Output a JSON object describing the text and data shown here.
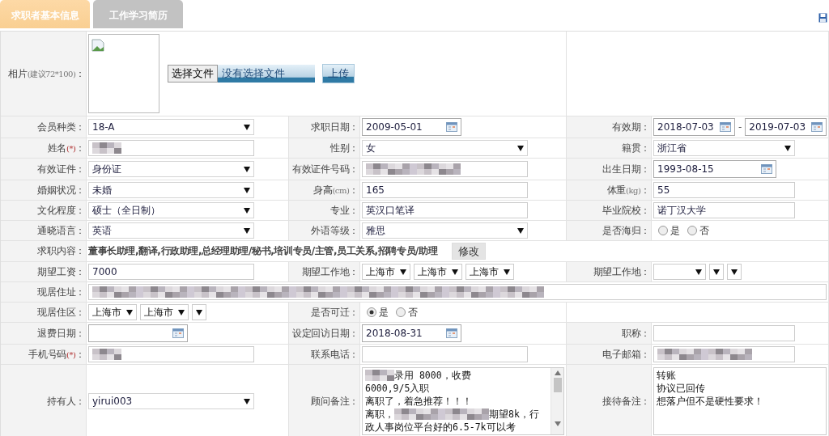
{
  "tabs": [
    {
      "label": "求职者基本信息",
      "selected": true
    },
    {
      "label": "工作学习简历",
      "selected": false
    }
  ],
  "rows": [
    {
      "fields": [
        {
          "label": [
            {
              "text": "相片"
            },
            {
              "text": "(建议72*100)",
              "kind": "note"
            },
            {
              "text": "："
            }
          ],
          "control": {
            "kind": "upload",
            "choose": "选择文件",
            "status": "没有选择文件",
            "upload": "上传"
          }
        }
      ]
    },
    {
      "fields": [
        {
          "label": "会员种类：",
          "control": {
            "kind": "select",
            "value": "18-A"
          }
        },
        {
          "label": "求职日期：",
          "control": {
            "kind": "date",
            "value": "2009-05-01"
          }
        },
        {
          "label": "有效期：",
          "control": {
            "kind": "daterange",
            "from": "2018-07-03",
            "separator": "-",
            "to": "2019-07-03"
          }
        }
      ]
    },
    {
      "fields": [
        {
          "label": [
            {
              "text": "姓名"
            },
            {
              "text": "(*)",
              "kind": "required"
            },
            {
              "text": "："
            }
          ],
          "control": {
            "kind": "masked"
          }
        },
        {
          "label": "性别：",
          "control": {
            "kind": "select",
            "value": "女"
          }
        },
        {
          "label": "籍贯：",
          "control": {
            "kind": "select",
            "value": "浙江省"
          }
        }
      ]
    },
    {
      "fields": [
        {
          "label": "有效证件：",
          "control": {
            "kind": "select",
            "value": "身份证"
          }
        },
        {
          "label": "有效证件号码：",
          "control": {
            "kind": "masked"
          }
        },
        {
          "label": "出生日期：",
          "control": {
            "kind": "date",
            "value": "1993-08-15"
          }
        }
      ]
    },
    {
      "fields": [
        {
          "label": "婚姻状况：",
          "control": {
            "kind": "select",
            "value": "未婚"
          }
        },
        {
          "label": [
            {
              "text": "身高"
            },
            {
              "text": "(cm)",
              "kind": "note"
            },
            {
              "text": "："
            }
          ],
          "control": {
            "kind": "text",
            "value": "165"
          }
        },
        {
          "label": [
            {
              "text": "体重"
            },
            {
              "text": "(kg)",
              "kind": "note"
            },
            {
              "text": "："
            }
          ],
          "control": {
            "kind": "text",
            "value": "55"
          }
        }
      ]
    },
    {
      "fields": [
        {
          "label": "文化程度：",
          "control": {
            "kind": "select",
            "value": "硕士（全日制）"
          }
        },
        {
          "label": "专业：",
          "control": {
            "kind": "text",
            "value": "英汉口笔译"
          }
        },
        {
          "label": "毕业院校：",
          "control": {
            "kind": "text",
            "value": "诺丁汉大学"
          }
        }
      ]
    },
    {
      "fields": [
        {
          "label": "通晓语言：",
          "control": {
            "kind": "select",
            "value": "英语"
          }
        },
        {
          "label": "外语等级：",
          "control": {
            "kind": "select",
            "value": "雅思"
          }
        },
        {
          "label": "是否海归：",
          "control": {
            "kind": "radio",
            "options": [
              {
                "label": "是",
                "selected": false
              },
              {
                "label": "否",
                "selected": false
              }
            ]
          }
        }
      ]
    },
    {
      "fields": [
        {
          "label": "求职内容：",
          "control": {
            "kind": "jobs",
            "value": "董事长助理,翻译,行政助理,总经理助理/秘书,培训专员/主管,员工关系,招聘专员/助理",
            "button": "修改"
          }
        }
      ]
    },
    {
      "fields": [
        {
          "label": "期望工资：",
          "control": {
            "kind": "text",
            "value": "7000"
          }
        },
        {
          "label": "期望工作地：",
          "control": {
            "kind": "selects",
            "items": [
              {
                "value": "上海市"
              },
              {
                "value": "上海市"
              },
              {
                "value": "上海市"
              }
            ]
          }
        },
        {
          "label": "期望工作地：",
          "control": {
            "kind": "selects",
            "items": [
              {
                "kind": "blank"
              },
              {
                "kind": "blank"
              },
              {
                "kind": "blank"
              }
            ]
          }
        }
      ]
    },
    {
      "fields": [
        {
          "label": "现居住址：",
          "control": {
            "kind": "masked-wide"
          }
        }
      ]
    },
    {
      "fields": [
        {
          "label": "现居住区：",
          "control": {
            "kind": "selects",
            "items": [
              {
                "value": "上海市"
              },
              {
                "value": "上海市"
              },
              {
                "kind": "blank"
              }
            ]
          }
        },
        {
          "label": "是否可迁：",
          "control": {
            "kind": "radio",
            "options": [
              {
                "label": "是",
                "selected": true
              },
              {
                "label": "否",
                "selected": false
              }
            ]
          }
        }
      ]
    },
    {
      "fields": [
        {
          "label": "退费日期：",
          "control": {
            "kind": "date"
          }
        },
        {
          "label": "设定回访日期：",
          "control": {
            "kind": "date",
            "value": "2018-08-31"
          }
        },
        {
          "label": "职称：",
          "control": {
            "kind": "text"
          }
        }
      ]
    },
    {
      "fields": [
        {
          "label": [
            {
              "text": "手机号码"
            },
            {
              "text": "(*)",
              "kind": "required"
            },
            {
              "text": "："
            }
          ],
          "control": {
            "kind": "masked"
          }
        },
        {
          "label": "联系电话：",
          "control": {
            "kind": "text"
          }
        },
        {
          "label": "电子邮箱：",
          "control": {
            "kind": "masked"
          }
        }
      ]
    },
    {
      "fields": [
        {
          "label": "持有人：",
          "control": {
            "kind": "select",
            "value": "yirui003"
          }
        },
        {
          "label": "顾问备注：",
          "control": {
            "kind": "textarea",
            "scrollable": true,
            "lines": [
              [
                {
                  "kind": "mask"
                },
                {
                  "kind": "text",
                  "text": "录用  8000，收费"
                }
              ],
              [
                {
                  "kind": "text",
                  "text": "6000,9/5入职"
                }
              ],
              [
                {
                  "kind": "text",
                  "text": "离职了，着急推荐！！！"
                }
              ],
              [
                {
                  "kind": "text",
                  "text": "离职，"
                },
                {
                  "kind": "mask"
                },
                {
                  "kind": "text",
                  "text": "期望8k，行"
                }
              ],
              [
                {
                  "kind": "text",
                  "text": "政人事岗位平台好的6.5-7k可以考"
                }
              ]
            ]
          }
        },
        {
          "label": "接待备注：",
          "control": {
            "kind": "textarea",
            "scrollable": false,
            "lines": [
              [
                {
                  "kind": "text",
                  "text": "转账"
                }
              ],
              [
                {
                  "kind": "text",
                  "text": "协议已回传"
                }
              ],
              [
                {
                  "kind": "text",
                  "text": "想落户但不是硬性要求！"
                }
              ]
            ]
          }
        }
      ]
    }
  ]
}
